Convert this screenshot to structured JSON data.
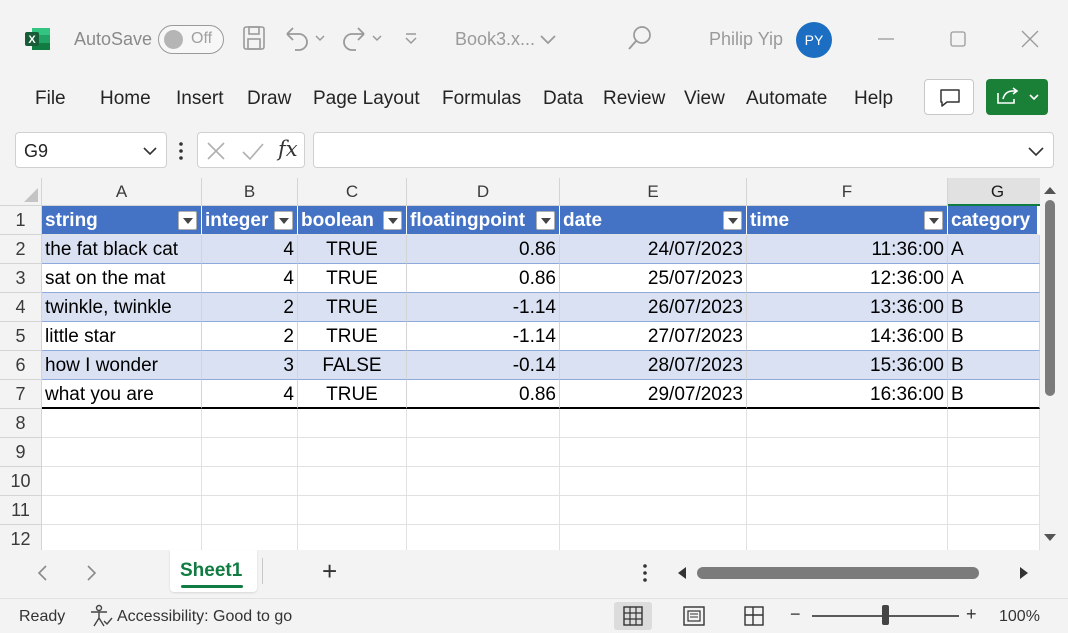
{
  "titlebar": {
    "autosave_label": "AutoSave",
    "autosave_state": "Off",
    "filename": "Book3.x...",
    "username": "Philip Yip",
    "avatar_initials": "PY",
    "icons": [
      "excel-logo-icon",
      "save-icon",
      "undo-icon",
      "redo-icon",
      "customize-qat-icon",
      "search-icon",
      "minimize-icon",
      "maximize-icon",
      "close-icon"
    ]
  },
  "ribbon": {
    "tabs": [
      "File",
      "Home",
      "Insert",
      "Draw",
      "Page Layout",
      "Formulas",
      "Data",
      "Review",
      "View",
      "Automate",
      "Help"
    ]
  },
  "formula_bar": {
    "name_box": "G9",
    "formula": "",
    "fx_label": "fx"
  },
  "grid": {
    "columns": [
      "A",
      "B",
      "C",
      "D",
      "E",
      "F",
      "G"
    ],
    "selected_column": "G",
    "row_numbers": [
      "1",
      "2",
      "3",
      "4",
      "5",
      "6",
      "7",
      "8",
      "9",
      "10",
      "11",
      "12"
    ],
    "table_headers": [
      "string",
      "integer",
      "boolean",
      "floatingpoint",
      "date",
      "time",
      "category"
    ],
    "table_rows": [
      [
        "the fat black cat",
        "4",
        "TRUE",
        "0.86",
        "24/07/2023",
        "11:36:00",
        "A"
      ],
      [
        "sat on the mat",
        "4",
        "TRUE",
        "0.86",
        "25/07/2023",
        "12:36:00",
        "A"
      ],
      [
        "twinkle, twinkle",
        "2",
        "TRUE",
        "-1.14",
        "26/07/2023",
        "13:36:00",
        "B"
      ],
      [
        "little star",
        "2",
        "TRUE",
        "-1.14",
        "27/07/2023",
        "14:36:00",
        "B"
      ],
      [
        "how I wonder",
        "3",
        "FALSE",
        "-0.14",
        "28/07/2023",
        "15:36:00",
        "B"
      ],
      [
        "what you are",
        "4",
        "TRUE",
        "0.86",
        "29/07/2023",
        "16:36:00",
        "B"
      ]
    ],
    "colors": {
      "header_fill": "#4472c4",
      "band_fill": "#d9e1f2",
      "accent": "#107c41"
    }
  },
  "sheets": {
    "tabs": [
      "Sheet1"
    ],
    "active": "Sheet1",
    "add_label": "+"
  },
  "statusbar": {
    "ready": "Ready",
    "accessibility": "Accessibility: Good to go",
    "zoom": "100%",
    "zoom_minus": "−",
    "zoom_plus": "+"
  }
}
